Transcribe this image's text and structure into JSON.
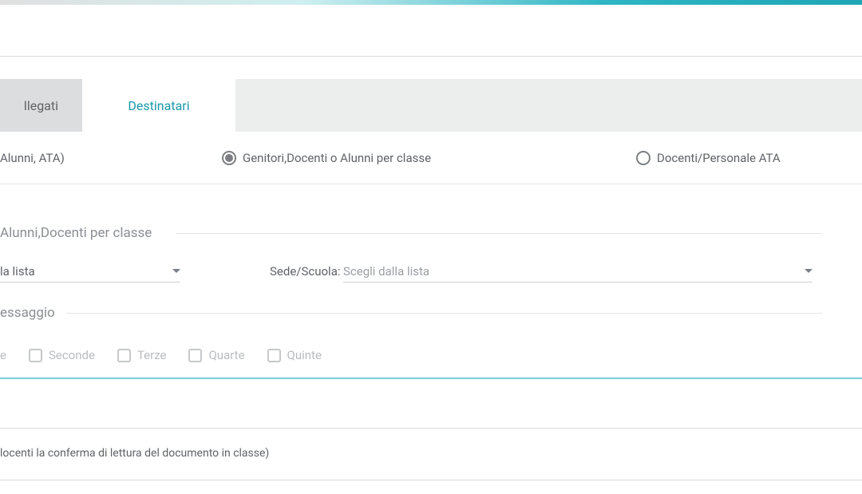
{
  "tabs": {
    "allegati": "llegati",
    "destinatari": "Destinatari"
  },
  "radios": {
    "all": " Alunni, ATA)",
    "per_classe": "Genitori,Docenti o Alunni per classe",
    "docenti_ata": "Docenti/Personale ATA"
  },
  "fieldset1": {
    "legend": "Alunni,Docenti per classe",
    "select1_text": "la lista",
    "sede_label": "Sede/Scuola:",
    "select2_placeholder": "Scegli dalla lista"
  },
  "fieldset2": {
    "legend": "essaggio",
    "checks": {
      "prime": "e",
      "seconde": "Seconde",
      "terze": "Terze",
      "quarte": "Quarte",
      "quinte": "Quinte"
    }
  },
  "footer": {
    "reading_confirm": "locenti la conferma di lettura del documento in classe)"
  }
}
